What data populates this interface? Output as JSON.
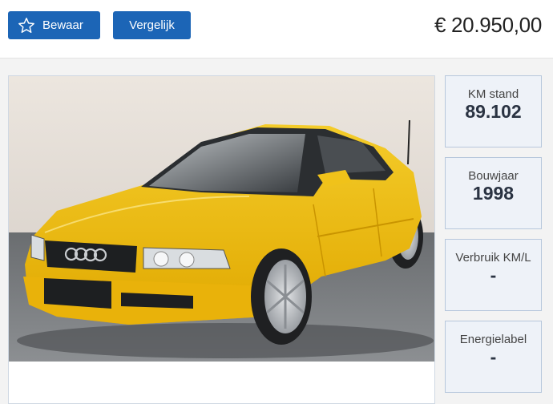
{
  "header": {
    "save_label": "Bewaar",
    "compare_label": "Vergelijk",
    "price": "€ 20.950,00"
  },
  "colors": {
    "accent": "#1c65b6",
    "stat_bg": "#eef2f8",
    "stat_border": "#b7c7dc"
  },
  "photo": {
    "subject": "yellow Audi sedan"
  },
  "stats": [
    {
      "label": "KM stand",
      "value": "89.102"
    },
    {
      "label": "Bouwjaar",
      "value": "1998"
    },
    {
      "label": "Verbruik KM/L",
      "value": "-"
    },
    {
      "label": "Energielabel",
      "value": "-"
    }
  ]
}
